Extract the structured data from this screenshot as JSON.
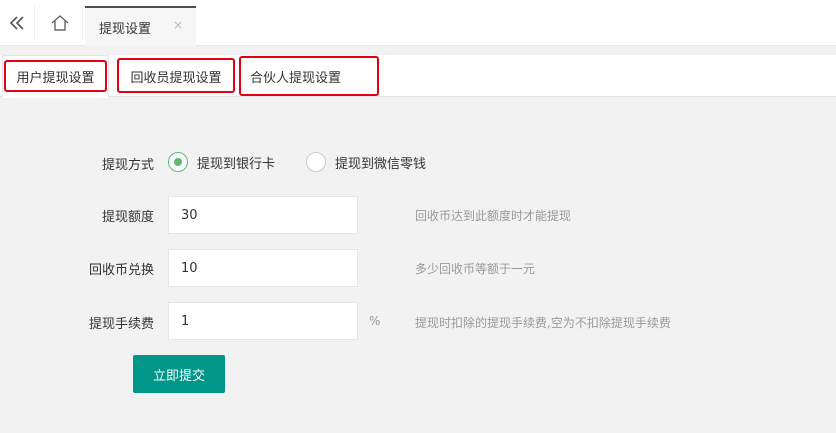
{
  "topbar": {
    "collapse_icon": "double-chevron-left-icon",
    "home_icon": "home-icon",
    "page_tab_label": "提现设置",
    "page_tab_close": "×"
  },
  "tabs": [
    {
      "label": "用户提现设置",
      "active": true
    },
    {
      "label": "回收员提现设置",
      "active": false
    },
    {
      "label": "合伙人提现设置",
      "active": false
    }
  ],
  "form": {
    "method_label": "提现方式",
    "method_options": [
      "提现到银行卡",
      "提现到微信零钱"
    ],
    "amount_label": "提现额度",
    "amount_value": "30",
    "amount_hint": "回收币达到此额度时才能提现",
    "exchange_label": "回收币兑换",
    "exchange_value": "10",
    "exchange_hint": "多少回收币等额于一元",
    "fee_label": "提现手续费",
    "fee_value": "1",
    "fee_unit": "%",
    "fee_hint": "提现时扣除的提现手续费,空为不扣除提现手续费",
    "submit_label": "立即提交"
  },
  "colors": {
    "accent": "#009688",
    "radio_checked": "#5fb878",
    "highlight": "#e60012"
  }
}
